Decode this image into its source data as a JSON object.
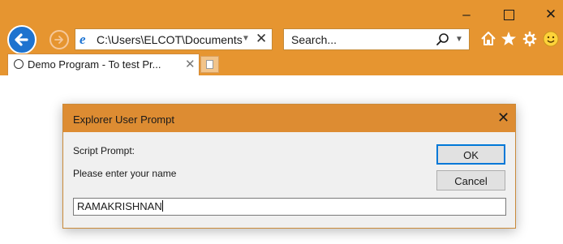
{
  "browser": {
    "address": "C:\\Users\\ELCOT\\Documents",
    "search_placeholder": "Search...",
    "tab_title": "Demo Program - To test Pr...",
    "accent_color": "#e69530"
  },
  "icons": {
    "back": "back-arrow-icon",
    "forward": "forward-arrow-icon",
    "home": "home-icon",
    "favorites": "star-icon",
    "tools": "gear-icon",
    "feedback": "smiley-icon"
  },
  "dialog": {
    "title": "Explorer User Prompt",
    "prompt_label": "Script Prompt:",
    "message": "Please enter your name",
    "ok_label": "OK",
    "cancel_label": "Cancel",
    "input_value": "RAMAKRISHNAN",
    "title_color": "#dd8c32"
  }
}
